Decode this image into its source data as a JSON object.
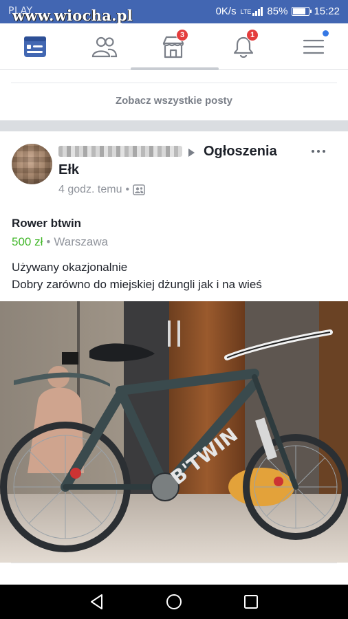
{
  "status_bar": {
    "carrier": "PLAY",
    "watermark": "www.wiocha.pl",
    "speed": "0K/s",
    "network": "LTE",
    "battery": "85%",
    "battery_level": 0.85,
    "time": "15:22"
  },
  "nav": {
    "items": [
      {
        "name": "news-feed",
        "icon": "news-feed-icon"
      },
      {
        "name": "friends",
        "icon": "friends-icon"
      },
      {
        "name": "marketplace",
        "icon": "marketplace-icon",
        "badge": "3"
      },
      {
        "name": "notifications",
        "icon": "bell-icon",
        "badge": "1"
      },
      {
        "name": "menu",
        "icon": "hamburger-menu-icon"
      }
    ]
  },
  "see_all_posts": "Zobacz wszystkie posty",
  "post": {
    "group": "Ogłoszenia",
    "city": "Ełk",
    "time": "4 godz. temu",
    "separator": "•",
    "item_title": "Rower btwin",
    "price": "500 zł",
    "location": "Warszawa",
    "description": [
      "Używany okazjonalnie",
      "Dobry zarówno do miejskiej dżungli jak i na wieś"
    ],
    "photo_text": "B'TWIN"
  },
  "colors": {
    "status_bar": "#4266b2",
    "accent": "#4267b2",
    "badge": "#e43d3d",
    "price": "#42b72a"
  }
}
